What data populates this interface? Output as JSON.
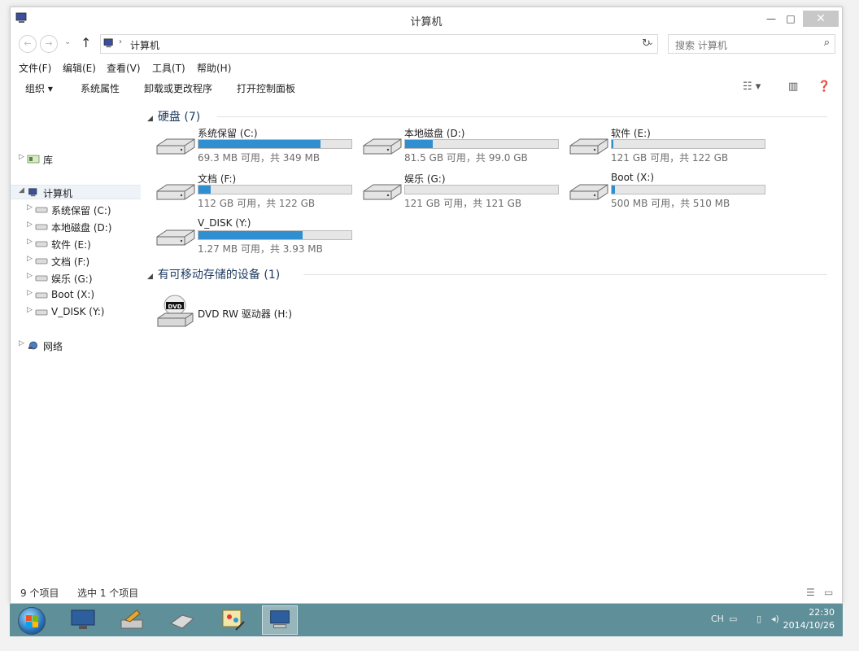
{
  "window": {
    "title": "计算机",
    "controls": {
      "minimize": "—",
      "maximize": "□",
      "close": "✕"
    }
  },
  "address": {
    "separator": "›",
    "path": "计算机",
    "search_placeholder": "搜索 计算机"
  },
  "menu": [
    "文件(F)",
    "编辑(E)",
    "查看(V)",
    "工具(T)",
    "帮助(H)"
  ],
  "toolbar": {
    "organize": "组织 ▾",
    "items": [
      "系统属性",
      "卸载或更改程序",
      "打开控制面板"
    ]
  },
  "nav": {
    "libraries": "库",
    "computer": "计算机",
    "drives": [
      "系统保留 (C:)",
      "本地磁盘 (D:)",
      "软件 (E:)",
      "文档 (F:)",
      "娱乐 (G:)",
      "Boot (X:)",
      "V_DISK (Y:)"
    ],
    "network": "网络"
  },
  "groups": {
    "hard_disks": "硬盘 (7)",
    "removable": "有可移动存储的设备 (1)"
  },
  "drives": [
    {
      "name": "系统保留 (C:)",
      "info": "69.3 MB 可用，共 349 MB",
      "used_fraction": 0.8
    },
    {
      "name": "本地磁盘 (D:)",
      "info": "81.5 GB 可用，共 99.0 GB",
      "used_fraction": 0.18
    },
    {
      "name": "软件 (E:)",
      "info": "121 GB 可用，共 122 GB",
      "used_fraction": 0.01
    },
    {
      "name": "文档 (F:)",
      "info": "112 GB 可用，共 122 GB",
      "used_fraction": 0.08
    },
    {
      "name": "娱乐 (G:)",
      "info": "121 GB 可用，共 121 GB",
      "used_fraction": 0.0
    },
    {
      "name": "Boot (X:)",
      "info": "500 MB 可用，共 510 MB",
      "used_fraction": 0.02
    },
    {
      "name": "V_DISK (Y:)",
      "info": "1.27 MB 可用，共 3.93 MB",
      "used_fraction": 0.68
    }
  ],
  "dvd": {
    "name": "DVD RW 驱动器 (H:)",
    "label": "DVD"
  },
  "status": {
    "count": "9 个项目",
    "selected": "选中 1 个项目"
  },
  "taskbar": {
    "tray": "CH",
    "time": "22:30",
    "date": "2014/10/26"
  },
  "colors": {
    "accent_bar": "#2f8fd1",
    "taskbar": "#5f8f99",
    "group_header": "#1e3a5f"
  }
}
